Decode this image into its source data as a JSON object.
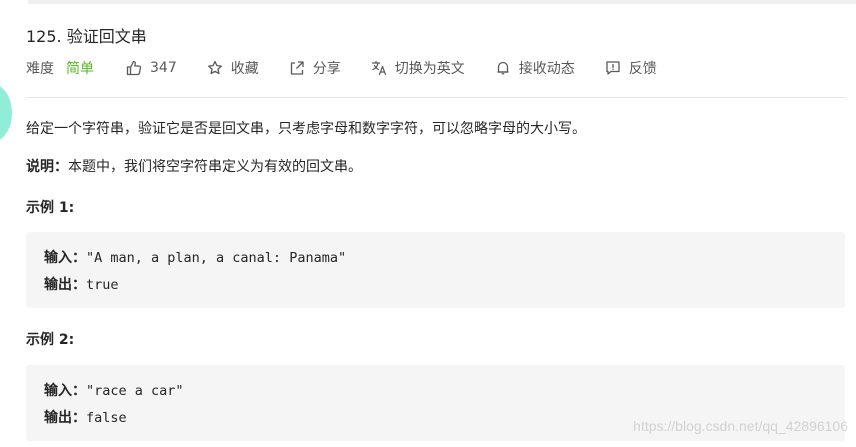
{
  "problem": {
    "title": "125. 验证回文串"
  },
  "meta": {
    "difficulty_label": "难度",
    "difficulty_value": "简单",
    "like_count": "347",
    "favorite_label": "收藏",
    "share_label": "分享",
    "switch_lang_label": "切换为英文",
    "notify_label": "接收动态",
    "feedback_label": "反馈"
  },
  "content": {
    "description": "给定一个字符串，验证它是否是回文串，只考虑字母和数字字符，可以忽略字母的大小写。",
    "note_label": "说明：",
    "note_text": "本题中，我们将空字符串定义为有效的回文串。"
  },
  "examples": [
    {
      "title": "示例 1:",
      "input_label": "输入：",
      "input_value": "\"A man, a plan, a canal: Panama\"",
      "output_label": "输出：",
      "output_value": "true"
    },
    {
      "title": "示例 2:",
      "input_label": "输入：",
      "input_value": "\"race a car\"",
      "output_label": "输出：",
      "output_value": "false"
    }
  ],
  "watermark": "https://blog.csdn.net/qq_42896106",
  "colors": {
    "easy": "#5ab726",
    "accent": "#35e0b8"
  }
}
